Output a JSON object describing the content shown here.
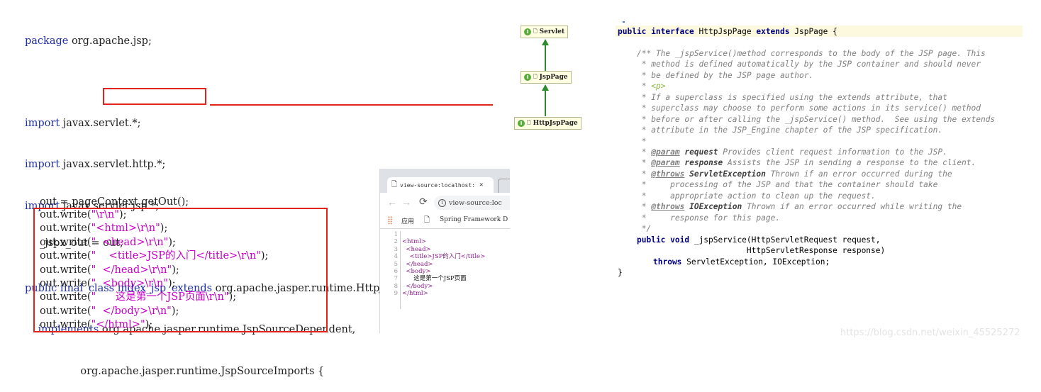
{
  "code_top": {
    "package_line": "package org.apache.jsp;",
    "imports": [
      "import javax.servlet.*;",
      "import javax.servlet.http.*;",
      "import javax.servlet.jsp.*;"
    ],
    "class_prefix": "public final ",
    "class_decl": "class index_jsp",
    "extends_kw": "extends",
    "extends_target": " org.apache.jasper.runtime.HttpJspBase",
    "implements_line": "    implements org.apache.jasper.runtime.JspSourceDependent,",
    "imports_line": "                 org.apache.jasper.runtime.JspSourceImports {"
  },
  "code_bottom": {
    "lines": [
      "out = pageContext.getOut();",
      "_jspx_out = out;"
    ],
    "writes": [
      {
        "pre": "out.write(",
        "str": "\"\\r\\n\"",
        "post": ");"
      },
      {
        "pre": "out.write(",
        "str": "\"<html>\\r\\n\"",
        "post": ");"
      },
      {
        "pre": "out.write(",
        "str": "\"  <head>\\r\\n\"",
        "post": ");"
      },
      {
        "pre": "out.write(",
        "str": "\"    <title>JSP的入门</title>\\r\\n\"",
        "post": ");"
      },
      {
        "pre": "out.write(",
        "str": "\"  </head>\\r\\n\"",
        "post": ");"
      },
      {
        "pre": "out.write(",
        "str": "\"  <body>\\r\\n\"",
        "post": ");"
      },
      {
        "pre": "out.write(",
        "str": "\"      这是第一个JSP页面\\r\\n\"",
        "post": ");"
      },
      {
        "pre": "out.write(",
        "str": "\"  </body>\\r\\n\"",
        "post": ");"
      },
      {
        "pre": "out.write(",
        "str": "\"</html>\"",
        "post": ");"
      }
    ]
  },
  "hierarchy": {
    "nodes": [
      "Servlet",
      "JspPage",
      "HttpJspPage"
    ],
    "icon_letter": "I"
  },
  "browser": {
    "tab_title": "view-source:localhost:",
    "url": "view-source:loc",
    "bookmarks": [
      "应用",
      "Spring Framework D"
    ],
    "source_lines": [
      {
        "n": "1",
        "t": ""
      },
      {
        "n": "2",
        "t": "<html>"
      },
      {
        "n": "3",
        "t": "  <head>"
      },
      {
        "n": "4",
        "t": "    <title>JSP的入门</title>"
      },
      {
        "n": "5",
        "t": "  </head>"
      },
      {
        "n": "6",
        "t": "  <body>"
      },
      {
        "n": "7",
        "t": "      这是第一个JSP页面"
      },
      {
        "n": "8",
        "t": "  </body>"
      },
      {
        "n": "9",
        "t": "</html>"
      }
    ]
  },
  "java_interface": {
    "decl_kw": "public interface",
    "decl_name": " HttpJspPage ",
    "decl_ext": "extends",
    "decl_tail": " JspPage {",
    "doc": [
      "/** The _jspService()method corresponds to the body of the JSP page. This",
      " * method is defined automatically by the JSP container and should never",
      " * be defined by the JSP page author.",
      " * <p>",
      " * If a superclass is specified using the extends attribute, that",
      " * superclass may choose to perform some actions in its service() method",
      " * before or after calling the _jspService() method.  See using the extends",
      " * attribute in the JSP_Engine chapter of the JSP specification.",
      " *"
    ],
    "params": [
      {
        "tag": "@param",
        "name": "request",
        "text": " Provides client request information to the JSP."
      },
      {
        "tag": "@param",
        "name": "response",
        "text": " Assists the JSP in sending a response to the client."
      },
      {
        "tag": "@throws",
        "name": "ServletException",
        "text": " Thrown if an error occurred during the"
      }
    ],
    "cont": [
      " *     processing of the JSP and that the container should take",
      " *     appropriate action to clean up the request."
    ],
    "throws2": {
      "tag": "@throws",
      "name": "IOException",
      "text": " Thrown if an error occurred while writing the"
    },
    "cont2": " *     response for this page.",
    "doc_end": " */",
    "method1_kw": "public void",
    "method1_rest": " _jspService(HttpServletRequest request,",
    "method2": "                       HttpServletResponse response)",
    "method3_kw": "throws",
    "method3_rest": " ServletException, IOException;",
    "close": "}"
  },
  "watermark": "https://blog.csdn.net/weixin_45525272"
}
